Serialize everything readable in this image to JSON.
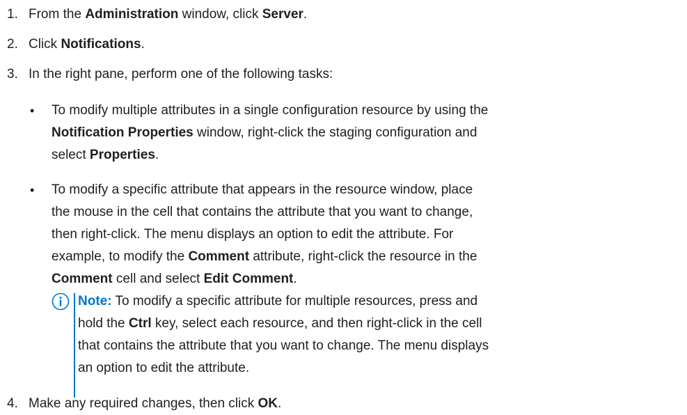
{
  "steps": [
    {
      "num": "1.",
      "parts": [
        "From the ",
        "Administration",
        " window, click ",
        "Server",
        "."
      ]
    },
    {
      "num": "2.",
      "parts": [
        "Click ",
        "Notifications",
        "."
      ]
    },
    {
      "num": "3.",
      "text": "In the right pane, perform one of the following tasks:"
    },
    {
      "num": "4.",
      "parts": [
        "Make any required changes, then click ",
        "OK",
        "."
      ]
    }
  ],
  "bullets": [
    {
      "dot": "•",
      "line1": "To modify multiple attributes in a single configuration resource by using the",
      "line2_parts": [
        "Notification Properties",
        " window, right-click the staging configuration and"
      ],
      "line3_parts": [
        "select ",
        "Properties",
        "."
      ]
    },
    {
      "dot": "•",
      "line1": "To modify a specific attribute that appears in the resource window, place",
      "line2": "the mouse in the cell that contains the attribute that you want to change,",
      "line3": "then right-click. The menu displays an option to edit the attribute. For",
      "line4_parts": [
        "example, to modify the ",
        "Comment",
        " attribute, right-click the resource in the"
      ],
      "line5_parts": [
        "Comment",
        " cell and select ",
        "Edit Comment",
        "."
      ]
    }
  ],
  "note": {
    "icon": "info-circle-icon",
    "label": "Note:",
    "line1": " To modify a specific attribute for multiple resources, press and",
    "line2_parts": [
      "hold the ",
      "Ctrl",
      " key, select each resource, and then right-click in the cell"
    ],
    "line3": "that contains the attribute that you want to change. The menu displays",
    "line4": "an option to edit the attribute.",
    "accent_color": "#0076ce"
  }
}
